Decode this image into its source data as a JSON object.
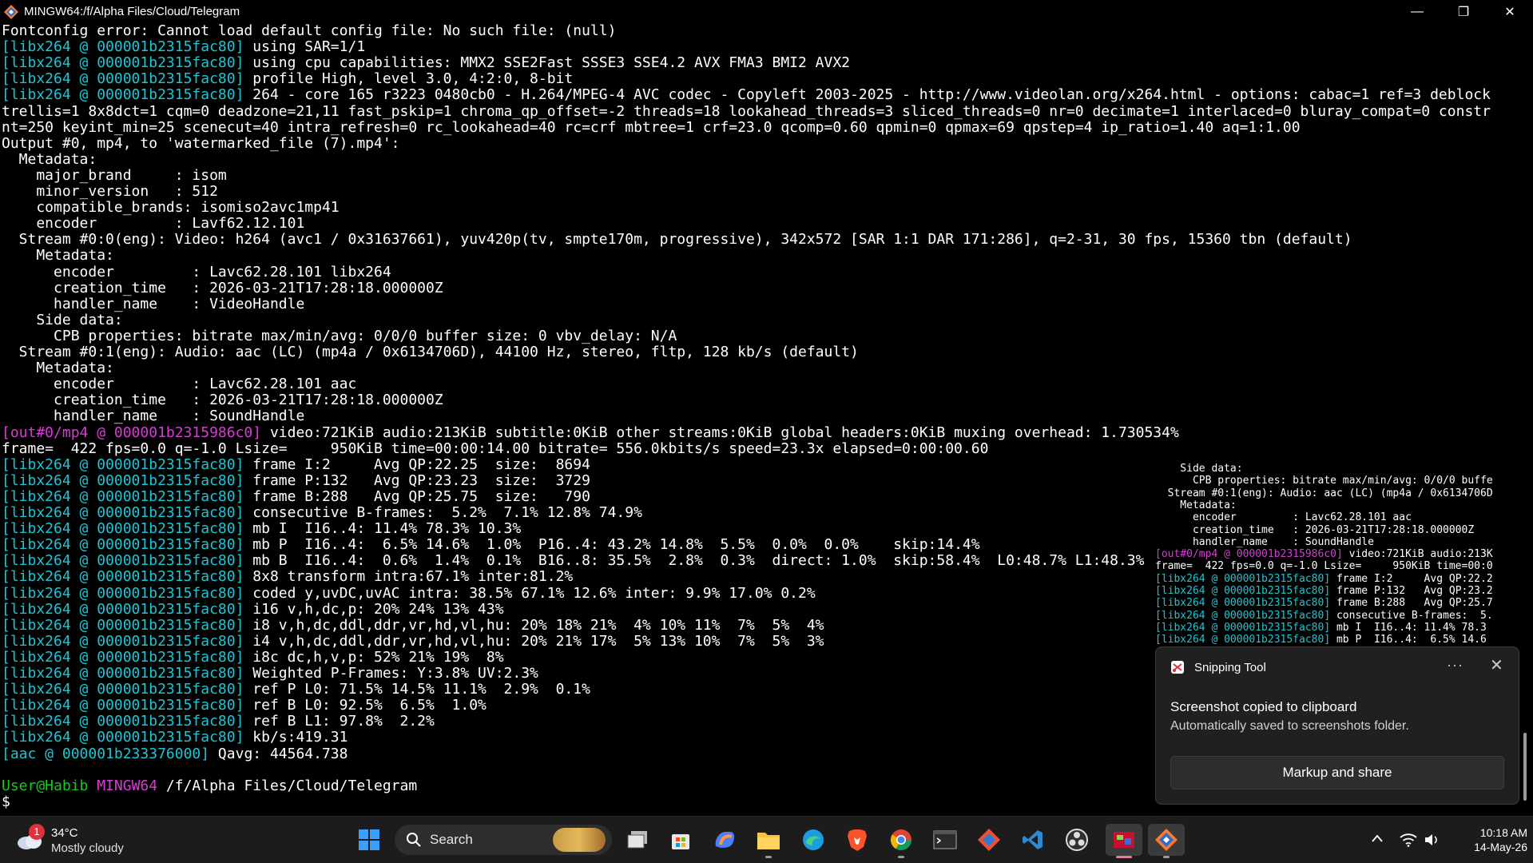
{
  "window": {
    "title": "MINGW64:/f/Alpha Files/Cloud/Telegram",
    "minimize": "—",
    "restore": "❐",
    "close": "✕"
  },
  "terminal_lines": [
    [
      {
        "t": "Fontconfig error: Cannot load default config file: No such file: (null)",
        "c": "white"
      }
    ],
    [
      {
        "t": "[libx264 @ 000001b2315fac80]",
        "c": "cyan"
      },
      {
        "t": " using SAR=1/1",
        "c": "white"
      }
    ],
    [
      {
        "t": "[libx264 @ 000001b2315fac80]",
        "c": "cyan"
      },
      {
        "t": " using cpu capabilities: MMX2 SSE2Fast SSSE3 SSE4.2 AVX FMA3 BMI2 AVX2",
        "c": "white"
      }
    ],
    [
      {
        "t": "[libx264 @ 000001b2315fac80]",
        "c": "cyan"
      },
      {
        "t": " profile High, level 3.0, 4:2:0, 8-bit",
        "c": "white"
      }
    ],
    [
      {
        "t": "[libx264 @ 000001b2315fac80]",
        "c": "cyan"
      },
      {
        "t": " 264 - core 165 r3223 0480cb0 - H.264/MPEG-4 AVC codec - Copyleft 2003-2025 - http://www.videolan.org/x264.html - options: cabac=1 ref=3 deblock",
        "c": "white"
      }
    ],
    [
      {
        "t": "trellis=1 8x8dct=1 cqm=0 deadzone=21,11 fast_pskip=1 chroma_qp_offset=-2 threads=18 lookahead_threads=3 sliced_threads=0 nr=0 decimate=1 interlaced=0 bluray_compat=0 constr",
        "c": "white"
      }
    ],
    [
      {
        "t": "nt=250 keyint_min=25 scenecut=40 intra_refresh=0 rc_lookahead=40 rc=crf mbtree=1 crf=23.0 qcomp=0.60 qpmin=0 qpmax=69 qpstep=4 ip_ratio=1.40 aq=1:1.00",
        "c": "white"
      }
    ],
    [
      {
        "t": "Output #0, mp4, to 'watermarked_file (7).mp4':",
        "c": "white"
      }
    ],
    [
      {
        "t": "  Metadata:",
        "c": "white"
      }
    ],
    [
      {
        "t": "    major_brand     : isom",
        "c": "white"
      }
    ],
    [
      {
        "t": "    minor_version   : 512",
        "c": "white"
      }
    ],
    [
      {
        "t": "    compatible_brands: isomiso2avc1mp41",
        "c": "white"
      }
    ],
    [
      {
        "t": "    encoder         : Lavf62.12.101",
        "c": "white"
      }
    ],
    [
      {
        "t": "  Stream #0:0(eng): Video: h264 (avc1 / 0x31637661), yuv420p(tv, smpte170m, progressive), 342x572 [SAR 1:1 DAR 171:286], q=2-31, 30 fps, 15360 tbn (default)",
        "c": "white"
      }
    ],
    [
      {
        "t": "    Metadata:",
        "c": "white"
      }
    ],
    [
      {
        "t": "      encoder         : Lavc62.28.101 libx264",
        "c": "white"
      }
    ],
    [
      {
        "t": "      creation_time   : 2026-03-21T17:28:18.000000Z",
        "c": "white"
      }
    ],
    [
      {
        "t": "      handler_name    : VideoHandle",
        "c": "white"
      }
    ],
    [
      {
        "t": "    Side data:",
        "c": "white"
      }
    ],
    [
      {
        "t": "      CPB properties: bitrate max/min/avg: 0/0/0 buffer size: 0 vbv_delay: N/A",
        "c": "white"
      }
    ],
    [
      {
        "t": "  Stream #0:1(eng): Audio: aac (LC) (mp4a / 0x6134706D), 44100 Hz, stereo, fltp, 128 kb/s (default)",
        "c": "white"
      }
    ],
    [
      {
        "t": "    Metadata:",
        "c": "white"
      }
    ],
    [
      {
        "t": "      encoder         : Lavc62.28.101 aac",
        "c": "white"
      }
    ],
    [
      {
        "t": "      creation_time   : 2026-03-21T17:28:18.000000Z",
        "c": "white"
      }
    ],
    [
      {
        "t": "      handler_name    : SoundHandle",
        "c": "white"
      }
    ],
    [
      {
        "t": "[out#0/mp4 @ 000001b2315986c0]",
        "c": "magenta"
      },
      {
        "t": " video:721KiB audio:213KiB subtitle:0KiB other streams:0KiB global headers:0KiB muxing overhead: 1.730534%",
        "c": "white"
      }
    ],
    [
      {
        "t": "frame=  422 fps=0.0 q=-1.0 Lsize=     950KiB time=00:00:14.00 bitrate= 556.0kbits/s speed=23.3x elapsed=0:00:00.60",
        "c": "white"
      }
    ],
    [
      {
        "t": "[libx264 @ 000001b2315fac80]",
        "c": "cyan"
      },
      {
        "t": " frame I:2     Avg QP:22.25  size:  8694",
        "c": "white"
      }
    ],
    [
      {
        "t": "[libx264 @ 000001b2315fac80]",
        "c": "cyan"
      },
      {
        "t": " frame P:132   Avg QP:23.23  size:  3729",
        "c": "white"
      }
    ],
    [
      {
        "t": "[libx264 @ 000001b2315fac80]",
        "c": "cyan"
      },
      {
        "t": " frame B:288   Avg QP:25.75  size:   790",
        "c": "white"
      }
    ],
    [
      {
        "t": "[libx264 @ 000001b2315fac80]",
        "c": "cyan"
      },
      {
        "t": " consecutive B-frames:  5.2%  7.1% 12.8% 74.9%",
        "c": "white"
      }
    ],
    [
      {
        "t": "[libx264 @ 000001b2315fac80]",
        "c": "cyan"
      },
      {
        "t": " mb I  I16..4: 11.4% 78.3% 10.3%",
        "c": "white"
      }
    ],
    [
      {
        "t": "[libx264 @ 000001b2315fac80]",
        "c": "cyan"
      },
      {
        "t": " mb P  I16..4:  6.5% 14.6%  1.0%  P16..4: 43.2% 14.8%  5.5%  0.0%  0.0%    skip:14.4%",
        "c": "white"
      }
    ],
    [
      {
        "t": "[libx264 @ 000001b2315fac80]",
        "c": "cyan"
      },
      {
        "t": " mb B  I16..4:  0.6%  1.4%  0.1%  B16..8: 35.5%  2.8%  0.3%  direct: 1.0%  skip:58.4%  L0:48.7% L1:48.3%",
        "c": "white"
      }
    ],
    [
      {
        "t": "[libx264 @ 000001b2315fac80]",
        "c": "cyan"
      },
      {
        "t": " 8x8 transform intra:67.1% inter:81.2%",
        "c": "white"
      }
    ],
    [
      {
        "t": "[libx264 @ 000001b2315fac80]",
        "c": "cyan"
      },
      {
        "t": " coded y,uvDC,uvAC intra: 38.5% 67.1% 12.6% inter: 9.9% 17.0% 0.2%",
        "c": "white"
      }
    ],
    [
      {
        "t": "[libx264 @ 000001b2315fac80]",
        "c": "cyan"
      },
      {
        "t": " i16 v,h,dc,p: 20% 24% 13% 43%",
        "c": "white"
      }
    ],
    [
      {
        "t": "[libx264 @ 000001b2315fac80]",
        "c": "cyan"
      },
      {
        "t": " i8 v,h,dc,ddl,ddr,vr,hd,vl,hu: 20% 18% 21%  4% 10% 11%  7%  5%  4%",
        "c": "white"
      }
    ],
    [
      {
        "t": "[libx264 @ 000001b2315fac80]",
        "c": "cyan"
      },
      {
        "t": " i4 v,h,dc,ddl,ddr,vr,hd,vl,hu: 20% 21% 17%  5% 13% 10%  7%  5%  3%",
        "c": "white"
      }
    ],
    [
      {
        "t": "[libx264 @ 000001b2315fac80]",
        "c": "cyan"
      },
      {
        "t": " i8c dc,h,v,p: 52% 21% 19%  8%",
        "c": "white"
      }
    ],
    [
      {
        "t": "[libx264 @ 000001b2315fac80]",
        "c": "cyan"
      },
      {
        "t": " Weighted P-Frames: Y:3.8% UV:2.3%",
        "c": "white"
      }
    ],
    [
      {
        "t": "[libx264 @ 000001b2315fac80]",
        "c": "cyan"
      },
      {
        "t": " ref P L0: 71.5% 14.5% 11.1%  2.9%  0.1%",
        "c": "white"
      }
    ],
    [
      {
        "t": "[libx264 @ 000001b2315fac80]",
        "c": "cyan"
      },
      {
        "t": " ref B L0: 92.5%  6.5%  1.0%",
        "c": "white"
      }
    ],
    [
      {
        "t": "[libx264 @ 000001b2315fac80]",
        "c": "cyan"
      },
      {
        "t": " ref B L1: 97.8%  2.2%",
        "c": "white"
      }
    ],
    [
      {
        "t": "[libx264 @ 000001b2315fac80]",
        "c": "cyan"
      },
      {
        "t": " kb/s:419.31",
        "c": "white"
      }
    ],
    [
      {
        "t": "[aac @ 000001b233376000]",
        "c": "cyan"
      },
      {
        "t": " Qavg: 44564.738",
        "c": "white"
      }
    ],
    [
      {
        "t": "",
        "c": "white"
      }
    ],
    [
      {
        "t": "User@Habib",
        "c": "green"
      },
      {
        "t": " ",
        "c": "white"
      },
      {
        "t": "MINGW64",
        "c": "magenta"
      },
      {
        "t": " /f/Alpha Files/Cloud/Telegram",
        "c": "white"
      }
    ],
    [
      {
        "t": "$",
        "c": "white"
      }
    ]
  ],
  "preview_lines": [
    [
      {
        "t": "    Side data:",
        "c": "white"
      }
    ],
    [
      {
        "t": "      CPB properties: bitrate max/min/avg: 0/0/0 buffe",
        "c": "white"
      }
    ],
    [
      {
        "t": "  Stream #0:1(eng): Audio: aac (LC) (mp4a / 0x6134706D",
        "c": "white"
      }
    ],
    [
      {
        "t": "    Metadata:",
        "c": "white"
      }
    ],
    [
      {
        "t": "      encoder         : Lavc62.28.101 aac",
        "c": "white"
      }
    ],
    [
      {
        "t": "      creation_time   : 2026-03-21T17:28:18.000000Z",
        "c": "white"
      }
    ],
    [
      {
        "t": "      handler_name    : SoundHandle",
        "c": "white"
      }
    ],
    [
      {
        "t": "[out#0/mp4 @ 000001b2315986c0]",
        "c": "magenta"
      },
      {
        "t": " video:721KiB audio:213K",
        "c": "white"
      }
    ],
    [
      {
        "t": "frame=  422 fps=0.0 q=-1.0 Lsize=     950KiB time=00:0",
        "c": "white"
      }
    ],
    [
      {
        "t": "[libx264 @ 000001b2315fac80]",
        "c": "cyan"
      },
      {
        "t": " frame I:2     Avg QP:22.2",
        "c": "white"
      }
    ],
    [
      {
        "t": "[libx264 @ 000001b2315fac80]",
        "c": "cyan"
      },
      {
        "t": " frame P:132   Avg QP:23.2",
        "c": "white"
      }
    ],
    [
      {
        "t": "[libx264 @ 000001b2315fac80]",
        "c": "cyan"
      },
      {
        "t": " frame B:288   Avg QP:25.7",
        "c": "white"
      }
    ],
    [
      {
        "t": "[libx264 @ 000001b2315fac80]",
        "c": "cyan"
      },
      {
        "t": " consecutive B-frames:  5.",
        "c": "white"
      }
    ],
    [
      {
        "t": "[libx264 @ 000001b2315fac80]",
        "c": "cyan"
      },
      {
        "t": " mb I  I16..4: 11.4% 78.3",
        "c": "white"
      }
    ],
    [
      {
        "t": "[libx264 @ 000001b2315fac80]",
        "c": "cyan"
      },
      {
        "t": " mb P  I16..4:  6.5% 14.6",
        "c": "white"
      }
    ]
  ],
  "toast": {
    "app_name": "Snipping Tool",
    "more": "···",
    "close": "✕",
    "heading": "Screenshot copied to clipboard",
    "subtext": "Automatically saved to screenshots folder.",
    "button": "Markup and share"
  },
  "taskbar": {
    "weather_badge": "1",
    "temperature": "34°C",
    "condition": "Mostly cloudy",
    "search_label": "Search",
    "time": "10:18 AM",
    "date": "14-May-26"
  },
  "icons": {
    "app": "git-bash-icon",
    "start": "windows-start-icon",
    "search": "search-icon",
    "task_view": "task-view-icon",
    "store": "microsoft-store-icon",
    "copilot": "copilot-icon",
    "explorer": "file-explorer-icon",
    "edge": "edge-icon",
    "brave": "brave-icon",
    "chrome": "chrome-icon",
    "terminal": "terminal-icon",
    "git": "git-icon",
    "vscode": "vscode-icon",
    "obs": "obs-icon"
  },
  "colors": {
    "cyan": "#19c8d6",
    "magenta": "#d83cd8",
    "green": "#19c919",
    "taskbar": "#1c1c1c"
  }
}
